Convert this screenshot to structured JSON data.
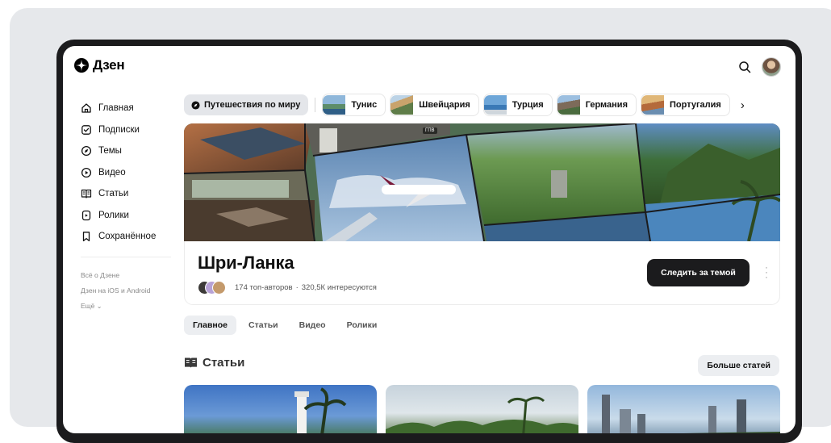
{
  "header": {
    "logo_text": "Дзен",
    "search_icon": "search-icon",
    "avatar": "user-avatar"
  },
  "sidebar": {
    "items": [
      {
        "label": "Главная",
        "icon": "home-icon"
      },
      {
        "label": "Подписки",
        "icon": "subscriptions-icon"
      },
      {
        "label": "Темы",
        "icon": "compass-icon"
      },
      {
        "label": "Видео",
        "icon": "video-play-icon"
      },
      {
        "label": "Статьи",
        "icon": "book-icon"
      },
      {
        "label": "Ролики",
        "icon": "shorts-icon"
      },
      {
        "label": "Сохранённое",
        "icon": "bookmark-icon"
      }
    ],
    "footer": {
      "about": "Всё о Дзене",
      "apps": "Дзен на iOS и Android",
      "more": "Ещё",
      "more_chevron": "⌄"
    }
  },
  "topics_bar": {
    "main": "Путешествия по миру",
    "chips": [
      "Тунис",
      "Швейцария",
      "Турция",
      "Германия",
      "Португалия"
    ],
    "next_arrow": "›"
  },
  "hero": {
    "tag": "ГПВ"
  },
  "topic": {
    "title": "Шри-Ланка",
    "authors": "174 топ-авторов",
    "separator": "·",
    "interested": "320,5К интересуются",
    "follow_label": "Следить за темой"
  },
  "tabs": [
    "Главное",
    "Статьи",
    "Видео",
    "Ролики"
  ],
  "articles": {
    "title": "Статьи",
    "more_label": "Больше статей"
  },
  "colors": {
    "accent_dark": "#1b1b1d",
    "chip_bg": "#e4e6ea",
    "backdrop": "#e6e8eb"
  }
}
